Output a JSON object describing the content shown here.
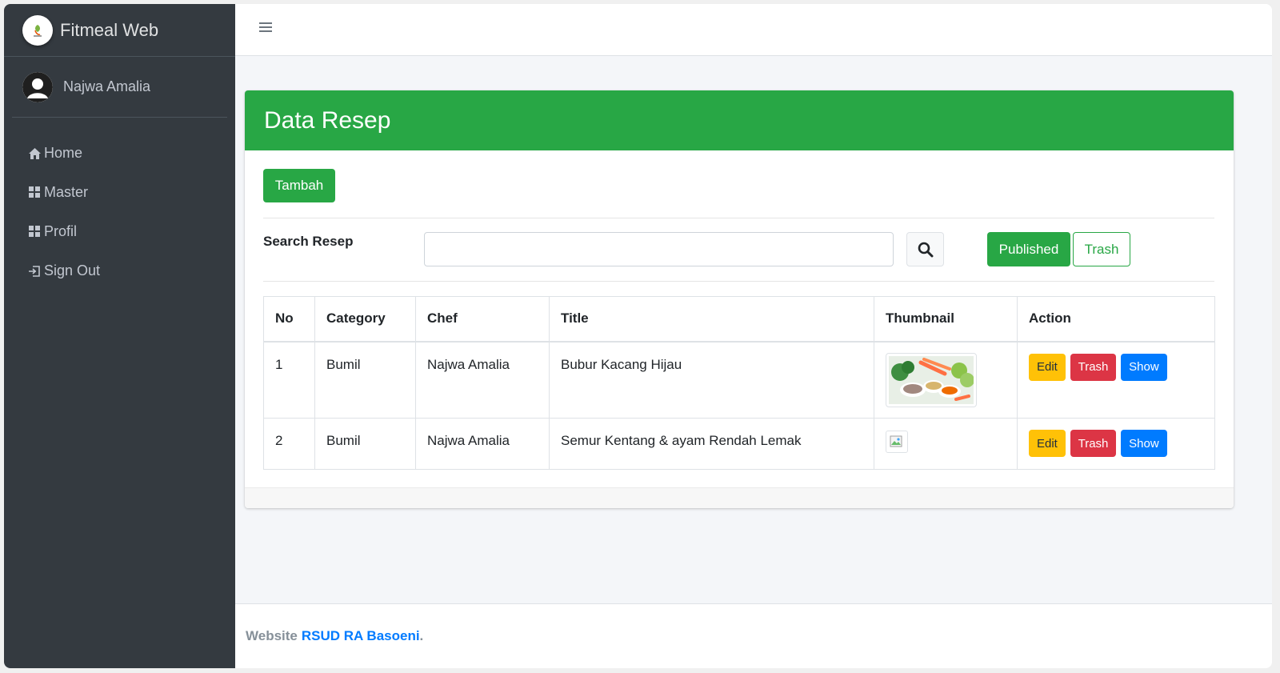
{
  "sidebar": {
    "brand": "Fitmeal Web",
    "user": "Najwa Amalia",
    "items": [
      {
        "label": "Home",
        "icon": "home-icon"
      },
      {
        "label": "Master",
        "icon": "grid-icon"
      },
      {
        "label": "Profil",
        "icon": "grid-icon"
      },
      {
        "label": "Sign Out",
        "icon": "sign-out-icon"
      }
    ]
  },
  "card": {
    "title": "Data Resep",
    "add_label": "Tambah",
    "search_label": "Search Resep",
    "search_value": "",
    "published_label": "Published",
    "trash_filter_label": "Trash"
  },
  "table": {
    "headers": [
      "No",
      "Category",
      "Chef",
      "Title",
      "Thumbnail",
      "Action"
    ],
    "rows": [
      {
        "no": "1",
        "category": "Bumil",
        "chef": "Najwa Amalia",
        "title": "Bubur Kacang Hijau"
      },
      {
        "no": "2",
        "category": "Bumil",
        "chef": "Najwa Amalia",
        "title": "Semur Kentang & ayam Rendah Lemak"
      }
    ],
    "actions": {
      "edit": "Edit",
      "trash": "Trash",
      "show": "Show"
    }
  },
  "footer": {
    "prefix": "Website",
    "link": "RSUD RA Basoeni",
    "suffix": "."
  },
  "colors": {
    "sidebar": "#343a40",
    "primary_green": "#28a745",
    "edit": "#ffc107",
    "trash": "#dc3545",
    "show": "#007bff"
  }
}
